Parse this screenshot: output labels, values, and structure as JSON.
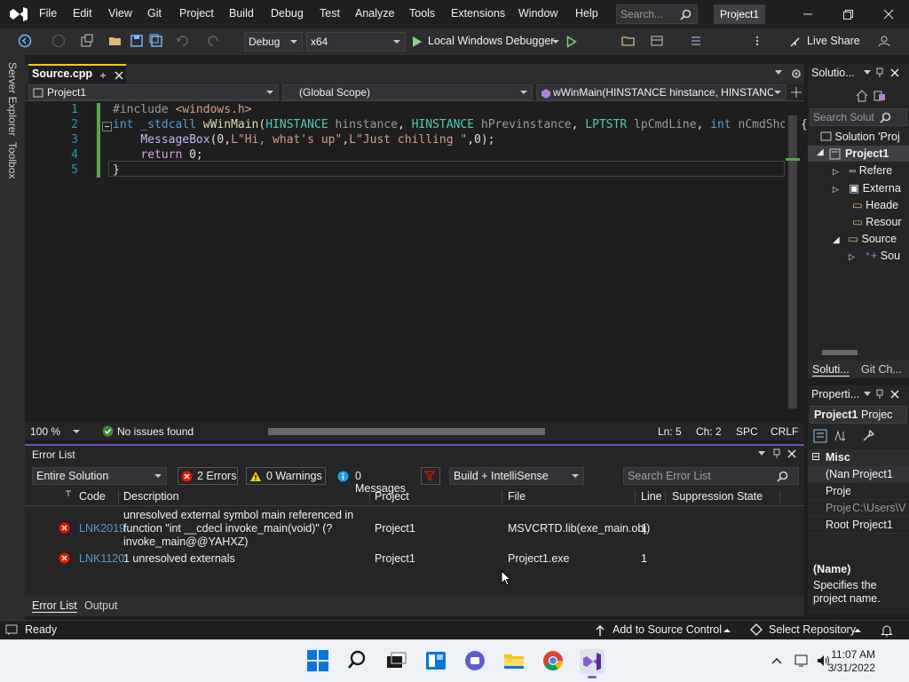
{
  "menu": {
    "items": [
      "File",
      "Edit",
      "View",
      "Git",
      "Project",
      "Build",
      "Debug",
      "Test",
      "Analyze",
      "Tools",
      "Extensions",
      "Window",
      "Help"
    ],
    "search_placeholder": "Search...",
    "project_badge": "Project1"
  },
  "toolbar": {
    "config": "Debug",
    "platform": "x64",
    "run_label": "Local Windows Debugger",
    "live_share": "Live Share"
  },
  "left_strip": {
    "server_explorer": "Server Explorer",
    "toolbox": "Toolbox"
  },
  "document": {
    "tab_name": "Source.cpp",
    "nav_project": "Project1",
    "nav_scope": "(Global Scope)",
    "nav_function": "wWinMain(HINSTANCE hinstance, HINSTANCE",
    "lines": [
      {
        "n": "1",
        "text": "#include <windows.h>"
      },
      {
        "n": "2",
        "text": "int _stdcall wWinMain(HINSTANCE hinstance, HINSTANCE hPrevinstance, LPTSTR lpCmdLine, int nCmdShow){"
      },
      {
        "n": "3",
        "text": "    MessageBox(0,L\"Hi, what's up\",L\"Just chilling \",0);"
      },
      {
        "n": "4",
        "text": "    return 0;"
      },
      {
        "n": "5",
        "text": "}"
      }
    ]
  },
  "editor_status": {
    "zoom": "100 %",
    "issues": "No issues found",
    "line": "Ln: 5",
    "col": "Ch: 2",
    "spc": "SPC",
    "eol": "CRLF"
  },
  "error_list": {
    "title": "Error List",
    "scope": "Entire Solution",
    "errors": "2 Errors",
    "warnings": "0 Warnings",
    "messages": "0 Messages",
    "source": "Build + IntelliSense",
    "search_placeholder": "Search Error List",
    "columns": [
      "Code",
      "Description",
      "Project",
      "File",
      "Line",
      "Suppression State"
    ],
    "rows": [
      {
        "code": "LNK2019",
        "desc1": "unresolved external symbol main referenced in",
        "desc2": "function \"int __cdecl invoke_main(void)\" (?",
        "desc3": "invoke_main@@YAHXZ)",
        "project": "Project1",
        "file": "MSVCRTD.lib(exe_main.obj)",
        "line": "1"
      },
      {
        "code": "LNK1120",
        "desc1": "1 unresolved externals",
        "project": "Project1",
        "file": "Project1.exe",
        "line": "1"
      }
    ],
    "tab_errors": "Error List",
    "tab_output": "Output"
  },
  "solution": {
    "title": "Solutio...",
    "search_placeholder": "Search Solut",
    "items": [
      "Solution 'Proj",
      "Project1",
      "Refere",
      "Externa",
      "Heade",
      "Resour",
      "Source",
      "Sou"
    ],
    "tab_solution": "Soluti...",
    "tab_git": "Git Ch..."
  },
  "properties": {
    "title": "Properti...",
    "object": "Project1",
    "object_type": "Projec",
    "section": "Misc",
    "rows": [
      {
        "k": "(Nan",
        "v": "Project1"
      },
      {
        "k": "Proje",
        "v": ""
      },
      {
        "k": "Proje",
        "v": "C:\\Users\\V"
      },
      {
        "k": "Root",
        "v": "Project1"
      }
    ],
    "desc_title": "(Name)",
    "desc_text": "Specifies the project name."
  },
  "statusbar": {
    "ready": "Ready",
    "source_control": "Add to Source Control",
    "repository": "Select Repository"
  },
  "taskbar": {
    "time": "11:07 AM",
    "date": "3/31/2022"
  },
  "colors": {
    "accent": "#6f4fbf",
    "error": "#e51400",
    "keyword": "#569cd6",
    "type": "#4ec9b0",
    "string": "#d69d85"
  }
}
